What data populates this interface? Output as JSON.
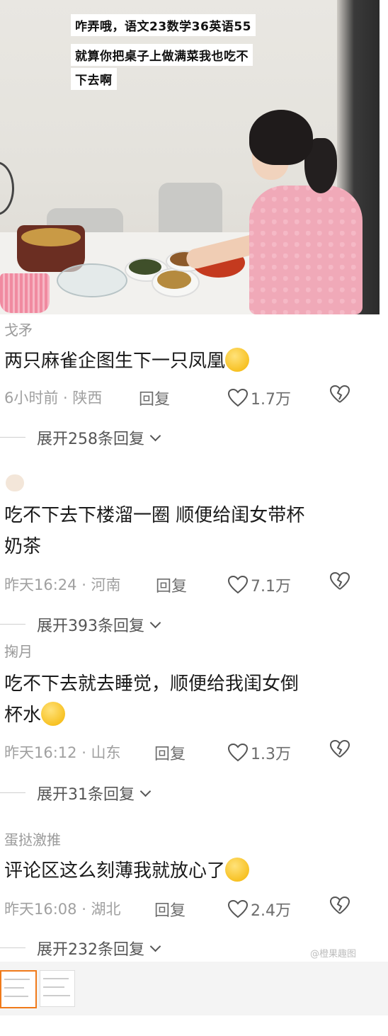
{
  "photo": {
    "caption_lines": [
      "咋弄哦，语文23数学36英语55",
      "就算你把桌子上做满菜我也吃不",
      "下去啊"
    ]
  },
  "comments": [
    {
      "author": "戈矛",
      "text_lines": [
        "两只麻雀企图生下一只凤凰"
      ],
      "emoji": "ok-hand-emoji",
      "time": "6小时前 · 陕西",
      "reply": "回复",
      "likes": "1.7万",
      "expand": "展开258条回复"
    },
    {
      "author": "",
      "text_lines": [
        "吃不下去下楼溜一圈 顺便给闺女带杯",
        "奶茶"
      ],
      "emoji": "",
      "time": "昨天16:24 · 河南",
      "reply": "回复",
      "likes": "7.1万",
      "expand": "展开393条回复"
    },
    {
      "author": "掬月",
      "text_lines": [
        "吃不下去就去睡觉，顺便给我闺女倒",
        "杯水"
      ],
      "emoji": "yum-face-emoji",
      "time": "昨天16:12 · 山东",
      "reply": "回复",
      "likes": "1.3万",
      "expand": "展开31条回复"
    },
    {
      "author": "蛋挞激推",
      "text_lines": [
        "评论区这么刻薄我就放心了"
      ],
      "emoji": "laughing-crying-emoji",
      "time": "昨天16:08 · 湖北",
      "reply": "回复",
      "likes": "2.4万",
      "expand": "展开232条回复"
    }
  ],
  "watermark": "@橙果趣图",
  "colors": {
    "thumb_active": "#f07a1a",
    "meta_gray": "#a0a0a0"
  }
}
